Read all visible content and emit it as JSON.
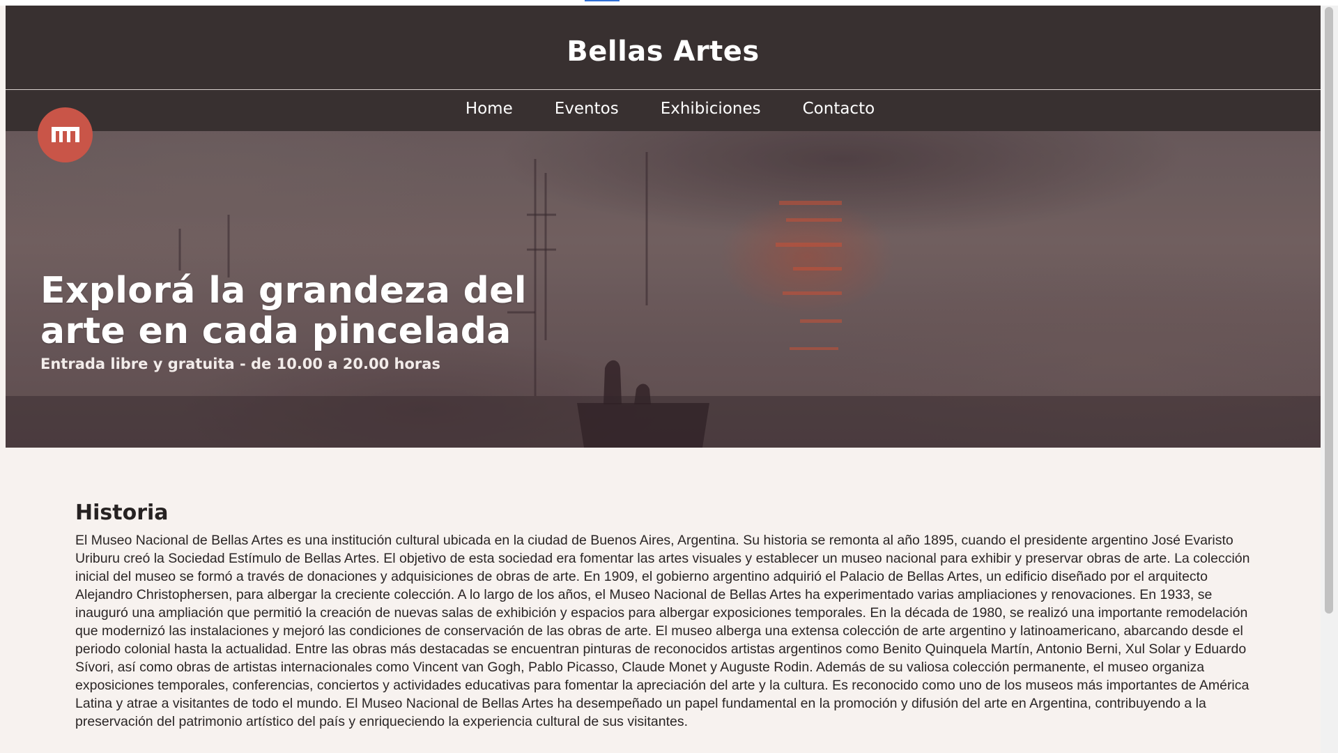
{
  "site": {
    "title": "Bellas Artes",
    "logo_icon": "museum-columns-icon",
    "logo_color": "#c95548"
  },
  "nav": {
    "items": [
      {
        "label": "Home"
      },
      {
        "label": "Eventos"
      },
      {
        "label": "Exhibiciones"
      },
      {
        "label": "Contacto"
      }
    ]
  },
  "hero": {
    "heading_line1": "Explorá la grandeza del",
    "heading_line2": "arte en cada pincelada",
    "subheading": "Entrada libre y gratuita - de 10.00 a 20.00 horas"
  },
  "historia": {
    "title": "Historia",
    "body": "El Museo Nacional de Bellas Artes es una institución cultural ubicada en la ciudad de Buenos Aires, Argentina. Su historia se remonta al año 1895, cuando el presidente argentino José Evaristo Uriburu creó la Sociedad Estímulo de Bellas Artes. El objetivo de esta sociedad era fomentar las artes visuales y establecer un museo nacional para exhibir y preservar obras de arte. La colección inicial del museo se formó a través de donaciones y adquisiciones de obras de arte. En 1909, el gobierno argentino adquirió el Palacio de Bellas Artes, un edificio diseñado por el arquitecto Alejandro Christophersen, para albergar la creciente colección. A lo largo de los años, el Museo Nacional de Bellas Artes ha experimentado varias ampliaciones y renovaciones. En 1933, se inauguró una ampliación que permitió la creación de nuevas salas de exhibición y espacios para albergar exposiciones temporales. En la década de 1980, se realizó una importante remodelación que modernizó las instalaciones y mejoró las condiciones de conservación de las obras de arte. El museo alberga una extensa colección de arte argentino y latinoamericano, abarcando desde el periodo colonial hasta la actualidad. Entre las obras más destacadas se encuentran pinturas de reconocidos artistas argentinos como Benito Quinquela Martín, Antonio Berni, Xul Solar y Eduardo Sívori, así como obras de artistas internacionales como Vincent van Gogh, Pablo Picasso, Claude Monet y Auguste Rodin. Además de su valiosa colección permanente, el museo organiza exposiciones temporales, conferencias, conciertos y actividades educativas para fomentar la apreciación del arte y la cultura. Es reconocido como uno de los museos más importantes de América Latina y atrae a visitantes de todo el mundo. El Museo Nacional de Bellas Artes ha desempeñado un papel fundamental en la promoción y difusión del arte en Argentina, contribuyendo a la preservación del patrimonio artístico del país y enriqueciendo la experiencia cultural de sus visitantes."
  },
  "colors": {
    "header_bg": "#383030",
    "page_bg": "#f7f2ef",
    "accent": "#c95548"
  }
}
